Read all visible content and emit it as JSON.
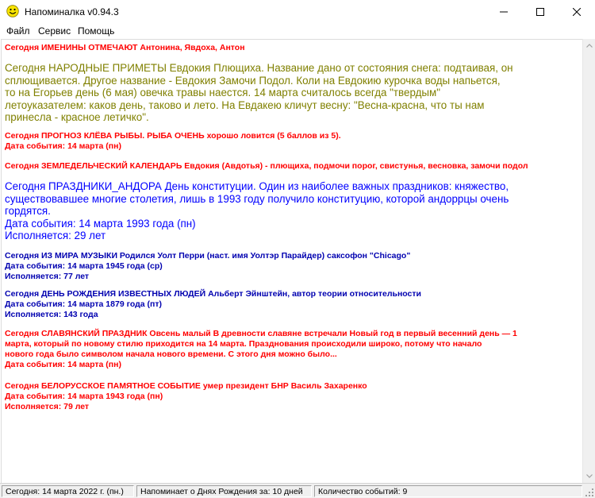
{
  "window": {
    "title": "Напоминалка v0.94.3",
    "icon": "smiley-face-icon",
    "controls": [
      "minimize-icon",
      "maximize-icon",
      "close-icon"
    ]
  },
  "menu": [
    "Файл",
    "Сервис",
    "Помощь"
  ],
  "colors": {
    "red": "#ff0000",
    "olive": "#808000",
    "blue": "#0000ff",
    "navy": "#0000b0",
    "icon_yellow": "#f7e300"
  },
  "events": [
    {
      "heading": "Сегодня ИМЕНИНЫ ОТМЕЧАЮТ Антонина, Явдоха, Антон"
    },
    {
      "heading": "Сегодня НАРОДНЫЕ ПРИМЕТЫ Евдокия Плющиха. Название дано от состояния снега: подтаивая, он",
      "lines": [
        "сплющивается. Другое название - Евдокия Замочи Подол. Коли на Евдокию курочка воды напьется,",
        "то на Егорьев день (6 мая) овечка травы наестся. 14 марта считалось всегда \"твердым\"",
        "летоуказателем: каков день, таково и лето. На Евдакею кличут весну: \"Весна-красна, что ты нам",
        "принесла - красное летичко\"."
      ]
    },
    {
      "heading": "Сегодня ПРОГНОЗ КЛЁВА РЫБЫ. РЫБА ОЧЕНЬ хорошо ловится (5 баллов из 5).",
      "lines": [
        "Дата события: 14 марта (пн)"
      ]
    },
    {
      "heading": "Сегодня ЗЕМЛЕДЕЛЬЧЕСКИЙ КАЛЕНДАРЬ Евдокия (Авдотья) - плющиха, подмочи порог, свистунья, весновка, замочи подол"
    },
    {
      "heading": "Сегодня ПРАЗДНИКИ_АНДОРА День конституции. Один из наиболее важных праздников: княжество,",
      "lines": [
        "существовавшее многие столетия, лишь в 1993 году получило конституцию, которой андоррцы очень",
        "гордятся.",
        "Дата события: 14 марта 1993 года (пн)",
        "Исполняется: 29 лет"
      ]
    },
    {
      "heading": "Сегодня ИЗ МИРА МУЗЫКИ Родился Уолт Перри (наст. имя Уолтэр Парайдер) саксофон \"Chicago\"",
      "lines": [
        "Дата события: 14 марта 1945 года (ср)",
        "Исполняется: 77 лет"
      ]
    },
    {
      "heading": "Сегодня ДЕНЬ РОЖДЕНИЯ ИЗВЕСТНЫХ ЛЮДЕЙ Альберт Эйнштейн, автор теории относительности",
      "lines": [
        "Дата события: 14 марта 1879 года (пт)",
        "Исполняется: 143 года"
      ]
    },
    {
      "heading": "Сегодня СЛАВЯНСКИЙ ПРАЗДНИК Овсень малый В древности славяне встречали Новый год в первый весенний день — 1",
      "lines": [
        "марта, который по новому стилю приходится на 14 марта. Празднования происходили широко, потому что начало",
        "нового года было символом начала нового времени. С этого дня можно было...",
        "Дата события: 14 марта (пн)"
      ]
    },
    {
      "heading": "Сегодня БЕЛОРУССКОЕ ПАМЯТНОЕ СОБЫТИЕ умер президент БНР Василь Захаренко",
      "lines": [
        "Дата события: 14 марта 1943 года (пн)",
        "Исполняется: 79 лет"
      ]
    }
  ],
  "status": {
    "today": "Сегодня: 14 марта 2022 г.  (пн.)",
    "reminder": "Напоминает о Днях Рождения за: 10 дней",
    "count": "Количество событий: 9"
  }
}
